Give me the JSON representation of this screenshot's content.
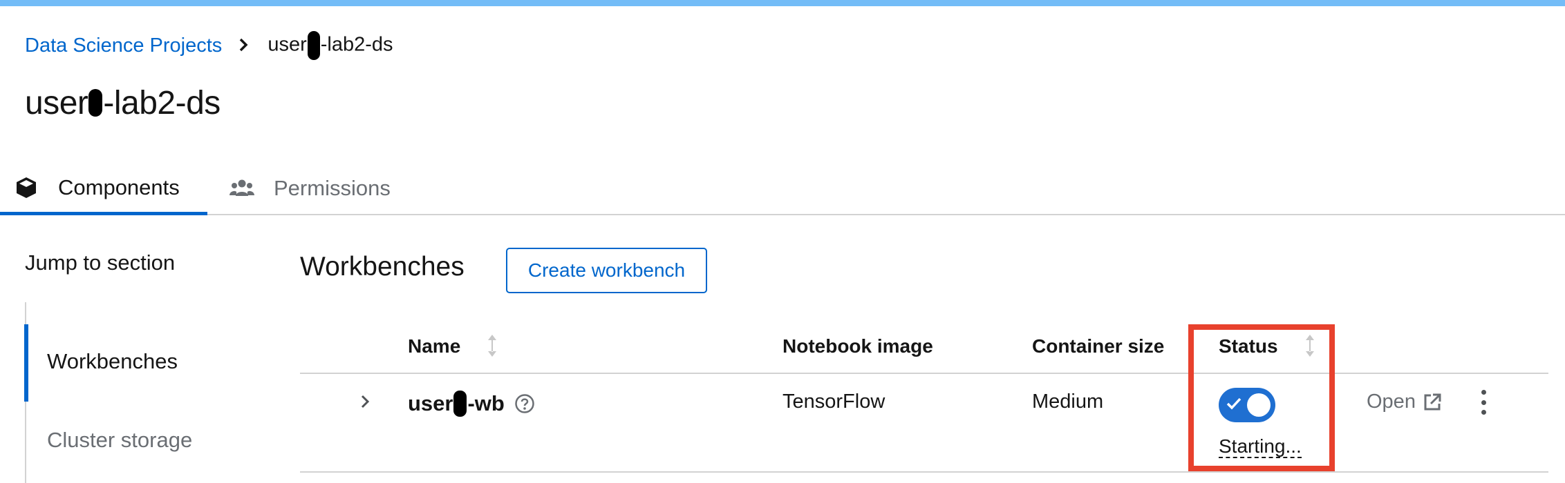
{
  "breadcrumb": {
    "parent": "Data Science Projects",
    "current_prefix": "user",
    "current_suffix": "-lab2-ds"
  },
  "page_title": {
    "prefix": "user",
    "suffix": "-lab2-ds"
  },
  "tabs": [
    {
      "label": "Components",
      "icon": "cube-icon",
      "selected": true
    },
    {
      "label": "Permissions",
      "icon": "users-icon",
      "selected": false
    }
  ],
  "jump_nav": {
    "title": "Jump to section",
    "items": [
      {
        "label": "Workbenches",
        "active": true
      },
      {
        "label": "Cluster storage",
        "active": false
      }
    ]
  },
  "workbenches": {
    "title": "Workbenches",
    "create_label": "Create workbench",
    "columns": [
      "Name",
      "Notebook image",
      "Container size",
      "Status"
    ],
    "rows": [
      {
        "name_prefix": "user",
        "name_suffix": "-wb",
        "notebook_image": "TensorFlow",
        "container_size": "Medium",
        "status": "Starting...",
        "toggle_on": true,
        "open_label": "Open"
      }
    ]
  },
  "colors": {
    "accent": "#0066cc",
    "toggle": "#1f6fd1",
    "highlight_box": "#e8412d",
    "top_bar": "#73bcf7"
  }
}
